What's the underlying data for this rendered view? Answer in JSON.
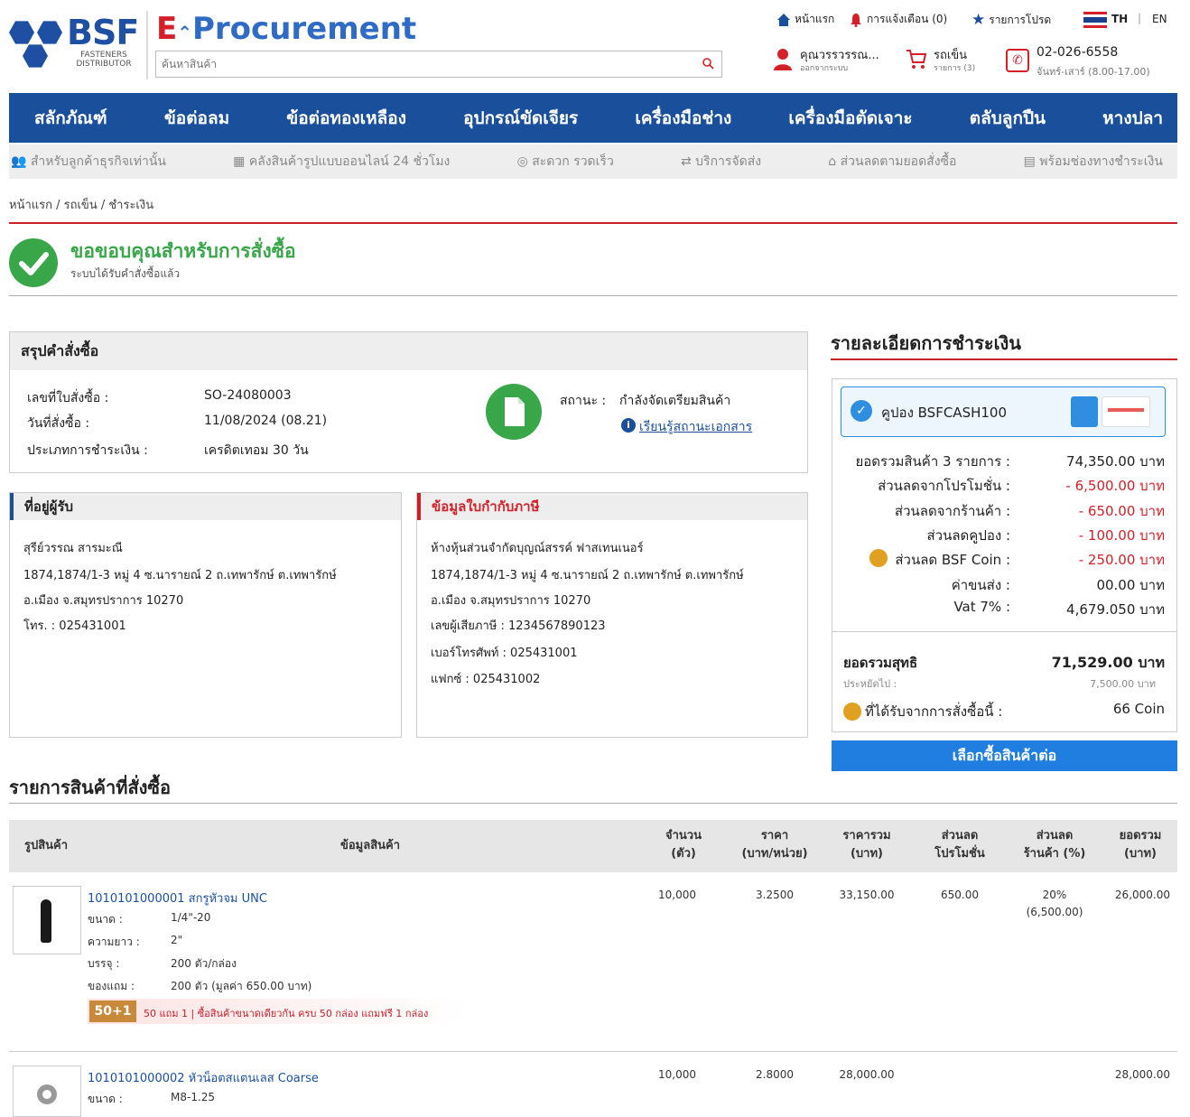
{
  "header": {
    "brand": "BSF",
    "brand_sub": "FASTENERS DISTRIBUTOR",
    "eproc_e": "E",
    "eproc_rest": "Procurement",
    "search_placeholder": "ค้นหาสินค้า",
    "home": "หน้าแรก",
    "notify": "การแจ้งเตือน (0)",
    "favorites": "รายการโปรด",
    "lang_th": "TH",
    "lang_en": "EN",
    "user_name": "คุณวรรวรรณ...",
    "user_sub": "ออกจากระบบ",
    "cart": "รถเข็น",
    "cart_sub": "รายการ (3)",
    "phone": "02-026-6558",
    "phone_hours": "จันทร์-เสาร์ (8.00-17.00)"
  },
  "nav": [
    "สลักภัณฑ์",
    "ข้อต่อลม",
    "ข้อต่อทองเหลือง",
    "อุปกรณ์ขัดเจียร",
    "เครื่องมือช่าง",
    "เครื่องมือตัดเจาะ",
    "ตลับลูกปืน",
    "หางปลา"
  ],
  "features": [
    "สำหรับลูกค้าธุรกิจเท่านั้น",
    "คลังสินค้ารูปแบบออนไลน์ 24 ชั่วโมง",
    "สะดวก รวดเร็ว",
    "บริการจัดส่ง",
    "ส่วนลดตามยอดสั่งซื้อ",
    "พร้อมช่องทางชำระเงิน"
  ],
  "breadcrumb": "หน้าแรก / รถเข็น / ชำระเงิน",
  "thanks": {
    "title": "ขอขอบคุณสำหรับการสั่งซื้อ",
    "sub": "ระบบได้รับคำสั่งซื้อแล้ว"
  },
  "summary": {
    "title": "สรุปคำสั่งซื้อ",
    "order_no_label": "เลขที่ใบสั่งซื้อ :",
    "order_no": "SO-24080003",
    "date_label": "วันที่สั่งซื้อ :",
    "date": "11/08/2024 (08.21)",
    "pay_type_label": "ประเภทการชำระเงิน :",
    "pay_type": "เครดิตเทอม 30 วัน",
    "status_label": "สถานะ :",
    "status": "กำลังจัดเตรียมสินค้า",
    "learn_link": "เรียนรู้สถานะเอกสาร"
  },
  "shipping": {
    "title": "ที่อยู่ผู้รับ",
    "name": "สุรีย์วรรณ สารมะณี",
    "addr1": "1874,1874/1-3 หมู่ 4 ซ.นารายณ์ 2 ถ.เทพารักษ์ ต.เทพารักษ์",
    "addr2": "อ.เมือง จ.สมุทรปราการ 10270",
    "tel": "โทร. : 025431001"
  },
  "tax": {
    "title": "ข้อมูลใบกำกับภาษี",
    "name": "ห้างหุ้นส่วนจำกัดบุญณ์สรรค์ ฟาสเทนเนอร์",
    "addr1": "1874,1874/1-3 หมู่ 4 ซ.นารายณ์ 2 ถ.เทพารักษ์ ต.เทพารักษ์",
    "addr2": "อ.เมือง จ.สมุทรปราการ 10270",
    "taxid": "เลขผู้เสียภาษี : 1234567890123",
    "phone": "เบอร์โทรศัพท์ : 025431001",
    "fax": "แฟกซ์ : 025431002"
  },
  "payment": {
    "title": "รายละเอียดการชำระเงิน",
    "coupon": "คูปอง BSFCASH100",
    "rows": [
      {
        "label": "ยอดรวมสินค้า 3 รายการ :",
        "value": "74,350.00 บาท",
        "red": false
      },
      {
        "label": "ส่วนลดจากโปรโมชั่น :",
        "value": "- 6,500.00 บาท",
        "red": true
      },
      {
        "label": "ส่วนลดจากร้านค้า :",
        "value": "- 650.00 บาท",
        "red": true
      },
      {
        "label": "ส่วนลดคูปอง :",
        "value": "- 100.00 บาท",
        "red": true
      },
      {
        "label": "ส่วนลด BSF Coin :",
        "value": "- 250.00 บาท",
        "red": true
      },
      {
        "label": "ค่าขนส่ง :",
        "value": "00.00 บาท",
        "red": false
      },
      {
        "label": "Vat 7% :",
        "value": "4,679.050 บาท",
        "red": false
      }
    ],
    "net_label": "ยอดรวมสุทธิ",
    "net_value": "71,529.00 บาท",
    "saved_label": "ประหยัดไป :",
    "saved_value": "7,500.00 บาท",
    "coin_label": "ที่ได้รับจากการสั่งซื้อนี้ :",
    "coin_value": "66 Coin",
    "continue_btn": "เลือกซื้อสินค้าต่อ"
  },
  "items_title": "รายการสินค้าที่สั่งซื้อ",
  "table": {
    "headers": [
      "รูปสินค้า",
      "ข้อมูลสินค้า",
      "จำนวน\n(ตัว)",
      "ราคา\n(บาท/หน่วย)",
      "ราคารวม\n(บาท)",
      "ส่วนลด\nโปรโมชั่น",
      "ส่วนลด\nร้านค้า (%)",
      "ยอดรวม\n(บาท)"
    ],
    "items": [
      {
        "name": "1010101000001 สกรูหัวจม UNC",
        "size_label": "ขนาด :",
        "size": "1/4\"-20",
        "length_label": "ความยาว :",
        "length": "2\"",
        "pack_label": "บรรจุ :",
        "pack": "200 ตัว/กล่อง",
        "gift_label": "ของแถม :",
        "gift": "200 ตัว (มูลค่า 650.00 บาท)",
        "promo_badge": "50+1",
        "promo": "50 แถม 1 | ซื้อสินค้าขนาดเดียวกัน ครบ 50 กล่อง แถมฟรี 1 กล่อง",
        "qty": "10,000",
        "price": "3.2500",
        "total": "33,150.00",
        "promo_disc": "650.00",
        "shop_disc": "20%",
        "shop_disc_amt": "(6,500.00)",
        "grand": "26,000.00"
      },
      {
        "name": "1010101000002 หัวน็อตสแตนเลส Coarse",
        "size_label": "ขนาด :",
        "size": "M8-1.25",
        "qty": "10,000",
        "price": "2.8000",
        "total": "28,000.00",
        "grand": "28,000.00"
      }
    ]
  }
}
